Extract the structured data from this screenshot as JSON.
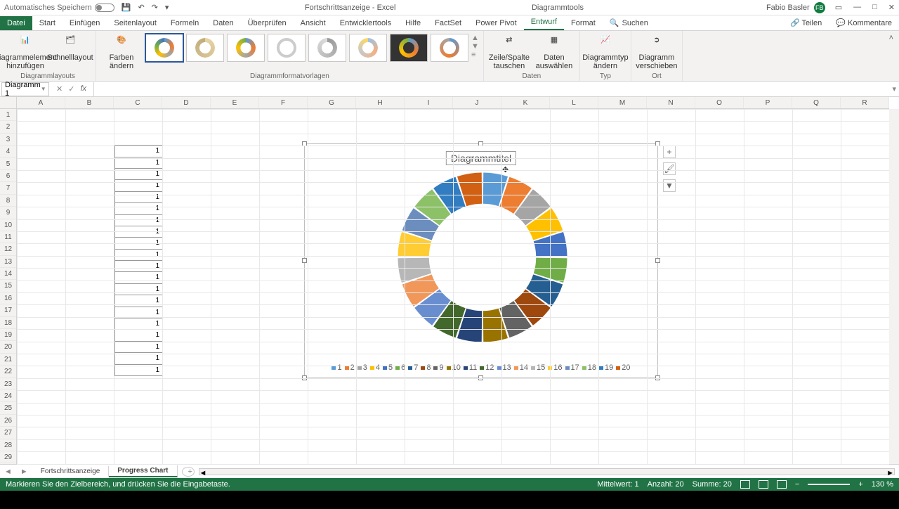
{
  "title_bar": {
    "autosave": "Automatisches Speichern",
    "doc": "Fortschrittsanzeige - Excel",
    "tool_context": "Diagrammtools",
    "user": "Fabio Basler",
    "user_initials": "FB"
  },
  "tabs": {
    "file": "Datei",
    "list": [
      "Start",
      "Einfügen",
      "Seitenlayout",
      "Formeln",
      "Daten",
      "Überprüfen",
      "Ansicht",
      "Entwicklertools",
      "Hilfe",
      "FactSet",
      "Power Pivot",
      "Entwurf",
      "Format"
    ],
    "active": "Entwurf",
    "search_icon": "🔍",
    "search": "Suchen",
    "share": "Teilen",
    "comments": "Kommentare"
  },
  "ribbon": {
    "layouts": {
      "btn1": "Diagrammelement hinzufügen",
      "btn2": "Schnelllayout",
      "group": "Diagrammlayouts"
    },
    "styles": {
      "colors": "Farben ändern",
      "group": "Diagrammformatvorlagen"
    },
    "data": {
      "switch": "Zeile/Spalte tauschen",
      "select": "Daten auswählen",
      "group": "Daten"
    },
    "type": {
      "change": "Diagrammtyp ändern",
      "group": "Typ"
    },
    "loc": {
      "move": "Diagramm verschieben",
      "group": "Ort"
    }
  },
  "namebox": "Diagramm 1",
  "columns": [
    "A",
    "B",
    "C",
    "D",
    "E",
    "F",
    "G",
    "H",
    "I",
    "J",
    "K",
    "L",
    "M",
    "N",
    "O",
    "P",
    "Q",
    "R"
  ],
  "data_values": [
    1,
    1,
    1,
    1,
    1,
    1,
    1,
    1,
    1,
    1,
    1,
    1,
    1,
    1,
    1,
    1,
    1,
    1,
    1,
    1
  ],
  "chart_data": {
    "type": "pie",
    "title": "Diagrammtitel",
    "series": [
      {
        "name": "",
        "values": [
          1,
          1,
          1,
          1,
          1,
          1,
          1,
          1,
          1,
          1,
          1,
          1,
          1,
          1,
          1,
          1,
          1,
          1,
          1,
          1
        ]
      }
    ],
    "categories": [
      "1",
      "2",
      "3",
      "4",
      "5",
      "6",
      "7",
      "8",
      "9",
      "10",
      "11",
      "12",
      "13",
      "14",
      "15",
      "16",
      "17",
      "18",
      "19",
      "20"
    ],
    "colors": [
      "#5b9bd5",
      "#ed7d31",
      "#a5a5a5",
      "#ffc000",
      "#4472c4",
      "#70ad47",
      "#255e91",
      "#9e480e",
      "#636363",
      "#997300",
      "#264478",
      "#43682b",
      "#698ed0",
      "#f1975a",
      "#b7b7b7",
      "#ffcd33",
      "#6c8ebf",
      "#8cc168",
      "#327dc2",
      "#d26012"
    ],
    "donut_hole": 0.62
  },
  "sheets": {
    "tab1": "Fortschrittsanzeige",
    "tab2": "Progress Chart",
    "active": "Progress Chart"
  },
  "status": {
    "msg": "Markieren Sie den Zielbereich, und drücken Sie die Eingabetaste.",
    "avg_l": "Mittelwert:",
    "avg": "1",
    "cnt_l": "Anzahl:",
    "cnt": "20",
    "sum_l": "Summe:",
    "sum": "20",
    "zoom": "130 %"
  }
}
